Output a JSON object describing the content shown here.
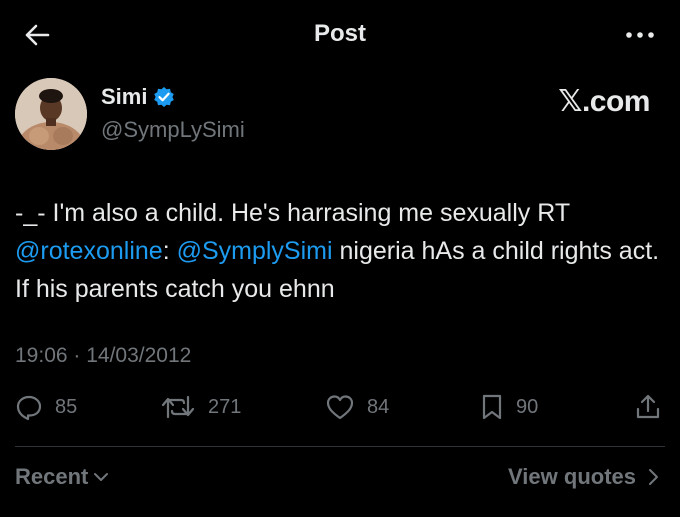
{
  "header": {
    "title": "Post",
    "back_icon": "arrow-left-icon",
    "more_icon": "more-horizontal-icon"
  },
  "author": {
    "name": "Simi",
    "handle": "@SympLySimi",
    "verified_icon": "verified-badge-icon",
    "verified_color": "#1d9bf0"
  },
  "brand": {
    "label": "𝕏.com"
  },
  "post": {
    "text_before": "-_- I'm also a child. He's harrasing me sexually RT ",
    "mention_1": "@rotexonline",
    "text_middle": ": ",
    "mention_2": "@SymplySimi",
    "text_after": " nigeria hAs a child rights act. If his parents catch you ehnn",
    "timestamp": "19:06 · 14/03/2012"
  },
  "actions": {
    "replies": "85",
    "reposts": "271",
    "likes": "84",
    "bookmarks": "90"
  },
  "footer": {
    "sort_label": "Recent",
    "quotes_label": "View quotes"
  },
  "colors": {
    "background": "#000000",
    "text": "#e7e9ea",
    "muted": "#71767b",
    "accent": "#1d9bf0",
    "divider": "#2f3336"
  }
}
